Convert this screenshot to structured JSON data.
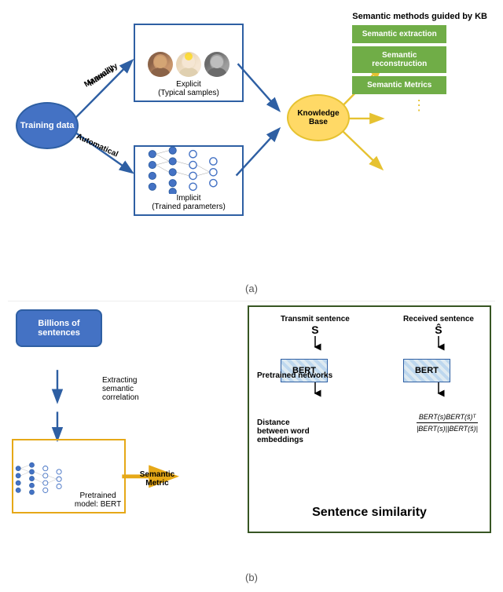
{
  "partA": {
    "label": "(a)",
    "trainingData": "Training data",
    "manuallyLabel": "Manually",
    "automaticallyLabel": "Automatical",
    "explicitLabel": "Explicit",
    "explicitSub": "(Typical samples)",
    "implicitLabel": "Implicit",
    "implicitSub": "(Trained parameters)",
    "knowledgeBase": "Knowledge Base",
    "semanticMethodsTitle": "Semantic methods guided by KB",
    "semanticButtons": [
      "Semantic extraction",
      "Semantic reconstruction",
      "Semantic Metrics"
    ],
    "dots": "⋮"
  },
  "partB": {
    "label": "(b)",
    "billionsLabel": "Billions of sentences",
    "extractingLabel": "Extracting semantic correlation",
    "pretrainedLabel": "Pretrained model: BERT",
    "semanticMetric": "Semantic Metric",
    "transmitLabel": "Transmit sentence",
    "transmitVar": "S",
    "receivedLabel": "Received sentence",
    "receivedVar": "Ŝ",
    "pretrainedNetworks": "Pretrained networks",
    "distanceLabel": "Distance between word embeddings",
    "bert1": "BERT",
    "bert2": "BERT",
    "formulaTop": "BERT(s)BERT(ŝ)ᵀ",
    "formulaBot": "|BERT(s)||BERT(ŝ)|",
    "sentenceSimilarity": "Sentence similarity"
  }
}
